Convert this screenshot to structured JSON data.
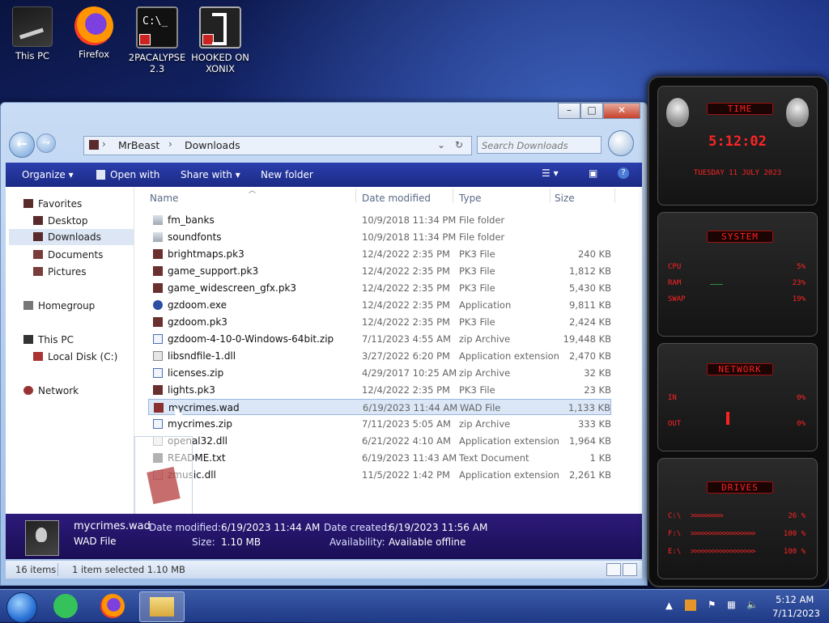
{
  "desktop": {
    "icons": [
      {
        "label": "This PC"
      },
      {
        "label": "Firefox"
      },
      {
        "label": "2PACALYPSE 2.3"
      },
      {
        "label": "HOOKED ON XONIX"
      }
    ]
  },
  "explorer": {
    "breadcrumb": [
      "MrBeast",
      "Downloads"
    ],
    "search_placeholder": "Search Downloads",
    "toolbar": {
      "organize": "Organize",
      "open_with": "Open with",
      "share_with": "Share with",
      "new_folder": "New folder"
    },
    "nav": {
      "favorites": "Favorites",
      "desktop": "Desktop",
      "downloads": "Downloads",
      "documents": "Documents",
      "pictures": "Pictures",
      "homegroup": "Homegroup",
      "this_pc": "This PC",
      "local_disk": "Local Disk (C:)",
      "network": "Network"
    },
    "columns": {
      "name": "Name",
      "date": "Date modified",
      "type": "Type",
      "size": "Size"
    },
    "files": [
      {
        "name": "fm_banks",
        "date": "10/9/2018 11:34 PM",
        "type": "File folder",
        "size": ""
      },
      {
        "name": "soundfonts",
        "date": "10/9/2018 11:34 PM",
        "type": "File folder",
        "size": ""
      },
      {
        "name": "brightmaps.pk3",
        "date": "12/4/2022 2:35 PM",
        "type": "PK3 File",
        "size": "240 KB"
      },
      {
        "name": "game_support.pk3",
        "date": "12/4/2022 2:35 PM",
        "type": "PK3 File",
        "size": "1,812 KB"
      },
      {
        "name": "game_widescreen_gfx.pk3",
        "date": "12/4/2022 2:35 PM",
        "type": "PK3 File",
        "size": "5,430 KB"
      },
      {
        "name": "gzdoom.exe",
        "date": "12/4/2022 2:35 PM",
        "type": "Application",
        "size": "9,811 KB"
      },
      {
        "name": "gzdoom.pk3",
        "date": "12/4/2022 2:35 PM",
        "type": "PK3 File",
        "size": "2,424 KB"
      },
      {
        "name": "gzdoom-4-10-0-Windows-64bit.zip",
        "date": "7/11/2023 4:55 AM",
        "type": "zip Archive",
        "size": "19,448 KB"
      },
      {
        "name": "libsndfile-1.dll",
        "date": "3/27/2022 6:20 PM",
        "type": "Application extension",
        "size": "2,470 KB"
      },
      {
        "name": "licenses.zip",
        "date": "4/29/2017 10:25 AM",
        "type": "zip Archive",
        "size": "32 KB"
      },
      {
        "name": "lights.pk3",
        "date": "12/4/2022 2:35 PM",
        "type": "PK3 File",
        "size": "23 KB"
      },
      {
        "name": "mycrimes.wad",
        "date": "6/19/2023 11:44 AM",
        "type": "WAD File",
        "size": "1,133 KB"
      },
      {
        "name": "mycrimes.zip",
        "date": "7/11/2023 5:05 AM",
        "type": "zip Archive",
        "size": "333 KB"
      },
      {
        "name": "openal32.dll",
        "date": "6/21/2022 4:10 AM",
        "type": "Application extension",
        "size": "1,964 KB"
      },
      {
        "name": "README.txt",
        "date": "6/19/2023 11:43 AM",
        "type": "Text Document",
        "size": "1 KB"
      },
      {
        "name": "zmusic.dll",
        "date": "11/5/2022 1:42 PM",
        "type": "Application extension",
        "size": "2,261 KB"
      }
    ],
    "details": {
      "name": "mycrimes.wad",
      "type": "WAD File",
      "date_modified_label": "Date modified:",
      "date_modified": "6/19/2023 11:44 AM",
      "size_label": "Size:",
      "size": "1.10 MB",
      "date_created_label": "Date created:",
      "date_created": "6/19/2023 11:56 AM",
      "availability_label": "Availability:",
      "availability": "Available offline"
    },
    "status": {
      "count": "16 items",
      "selection": "1 item selected  1.10 MB"
    }
  },
  "widget": {
    "time_title": "TIME",
    "time": "5:12:02",
    "date": "TUESDAY 11 JULY 2023",
    "system_title": "SYSTEM",
    "cpu_label": "CPU",
    "cpu": "5%",
    "ram_label": "RAM",
    "ram": "23%",
    "swap_label": "SWAP",
    "swap": "19%",
    "network_title": "NETWORK",
    "in_label": "IN",
    "in": "0%",
    "out_label": "OUT",
    "out": "0%",
    "drives_title": "DRIVES",
    "drives": [
      {
        "label": "C:\\",
        "value": "26 %"
      },
      {
        "label": "F:\\",
        "value": "100 %"
      },
      {
        "label": "E:\\",
        "value": "100 %"
      }
    ]
  },
  "taskbar": {
    "time": "5:12 AM",
    "date": "7/11/2023"
  }
}
